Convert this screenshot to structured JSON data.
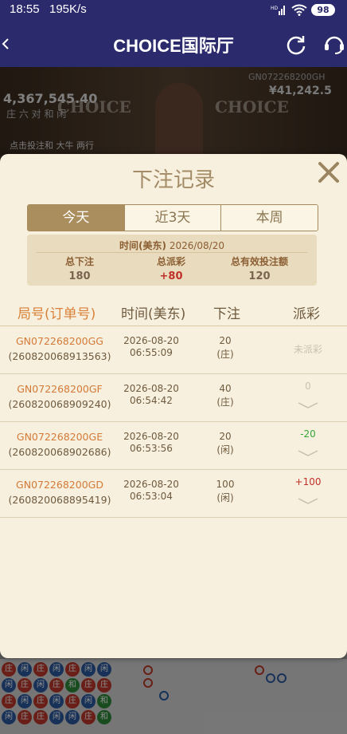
{
  "status_bar": {
    "time": "18:55",
    "speed": "195K/s",
    "signal_label": "HD",
    "battery": "98"
  },
  "header": {
    "back_icon": "chevron-left-icon",
    "title": "CHOICE国际厅",
    "refresh_icon": "refresh-icon",
    "support_icon": "headset-icon"
  },
  "background_game": {
    "left_amount": "4,367,545.40",
    "left_roadmap": "庄 六 对 和 闲",
    "bet_hint": "点击投注和 大牛 两行",
    "table_id": "GN072268200GH",
    "right_amount": "¥41,242.5",
    "logo": "CHOICE",
    "bead_labels": [
      "庄",
      "闲",
      "和"
    ]
  },
  "modal": {
    "title": "下注记录",
    "close_icon": "close-icon",
    "tabs": [
      {
        "label": "今天",
        "active": true
      },
      {
        "label": "近3天",
        "active": false
      },
      {
        "label": "本周",
        "active": false
      }
    ],
    "summary": {
      "date_label": "时间(美东)",
      "date_value": "2026/08/20",
      "total_bet_label": "总下注",
      "total_bet_value": "180",
      "total_payout_label": "总派彩",
      "total_payout_value": "+80",
      "valid_bet_label": "总有效投注额",
      "valid_bet_value": "120"
    },
    "table_headers": {
      "round": "局号(订单号)",
      "time": "时间(美东)",
      "bet": "下注",
      "payout": "派彩"
    },
    "rows": [
      {
        "round_id": "GN072268200GG",
        "order_id": "(260820068913563)",
        "date": "2026-08-20",
        "time": "06:55:09",
        "bet": "20",
        "side": "(庄)",
        "payout": "未派彩",
        "status": "pending"
      },
      {
        "round_id": "GN072268200GF",
        "order_id": "(260820068909240)",
        "date": "2026-08-20",
        "time": "06:54:42",
        "bet": "40",
        "side": "(庄)",
        "payout": "0",
        "status": "zero"
      },
      {
        "round_id": "GN072268200GE",
        "order_id": "(260820068902686)",
        "date": "2026-08-20",
        "time": "06:53:56",
        "bet": "20",
        "side": "(闲)",
        "payout": "-20",
        "status": "loss"
      },
      {
        "round_id": "GN072268200GD",
        "order_id": "(260820068895419)",
        "date": "2026-08-20",
        "time": "06:53:04",
        "bet": "100",
        "side": "(闲)",
        "payout": "+100",
        "status": "win"
      }
    ],
    "colors": {
      "accent": "#ab8e5e",
      "round_id": "#d47a38",
      "win": "#c0302a",
      "loss": "#35a537"
    }
  }
}
